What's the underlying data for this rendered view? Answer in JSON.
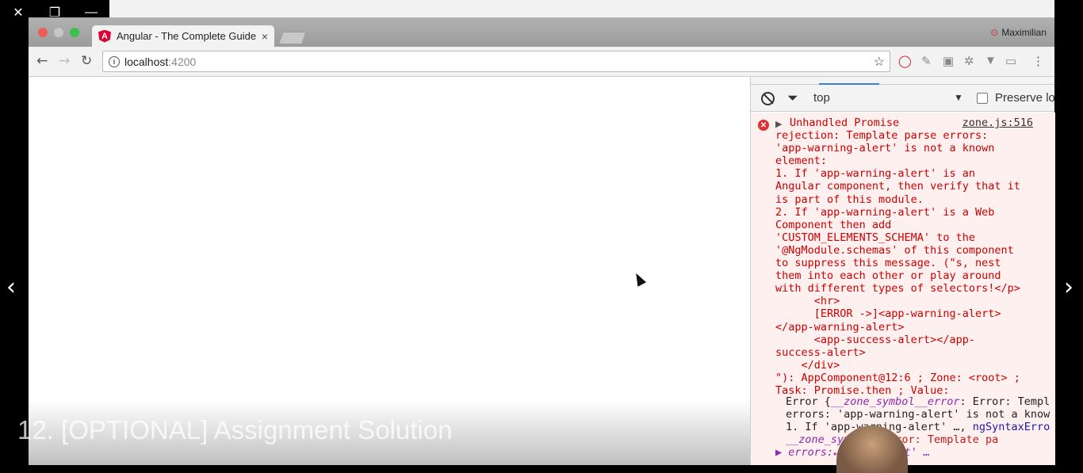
{
  "window": {
    "close": "✕",
    "restore": "❐",
    "minimize": "—"
  },
  "browser": {
    "tab_title": "Angular - The Complete Guide",
    "tab_close": "×",
    "profile_name": "Maximilian",
    "url_host": "localhost",
    "url_port": ":4200",
    "nav": {
      "back": "←",
      "forward": "→",
      "reload": "↻"
    }
  },
  "devtools": {
    "context": "top",
    "preserve_log": "Preserve lo",
    "error": {
      "source": "zone.js:516",
      "lines": "Unhandled Promise\nrejection: Template parse errors:\n'app-warning-alert' is not a known\nelement:\n1. If 'app-warning-alert' is an\nAngular component, then verify that it\nis part of this module.\n2. If 'app-warning-alert' is a Web\nComponent then add\n'CUSTOM_ELEMENTS_SCHEMA' to the\n'@NgModule.schemas' of this component\nto suppress this message. (\"s, nest\nthem into each other or play around\nwith different types of selectors!</p>\n      <hr>\n      [ERROR ->]<app-warning-alert>\n</app-warning-alert>\n      <app-success-alert></app-\nsuccess-alert>\n    </div>\n\"): AppComponent@12:6 ; Zone: <root> ;\nTask: Promise.then ; Value:",
      "obj_line1_a": "Error {",
      "obj_line1_b": "__zone_symbol__error",
      "obj_line1_c": ": Error: Templ",
      "obj_line2": "errors: 'app-warning-alert' is not a know",
      "obj_line3_a": "1. If 'app-warning-alert' …, ",
      "obj_line3_b": "ngSyntaxErro",
      "obj_line4_a": "__zone_sym",
      "obj_line4_b": "ck",
      "obj_line4_c": ": \"Error: Template pa",
      "obj_line5": "▶ errors:↵' ing-alert' …"
    }
  },
  "video": {
    "title": "12. [OPTIONAL] Assignment Solution",
    "prev": "‹",
    "next": "›"
  }
}
